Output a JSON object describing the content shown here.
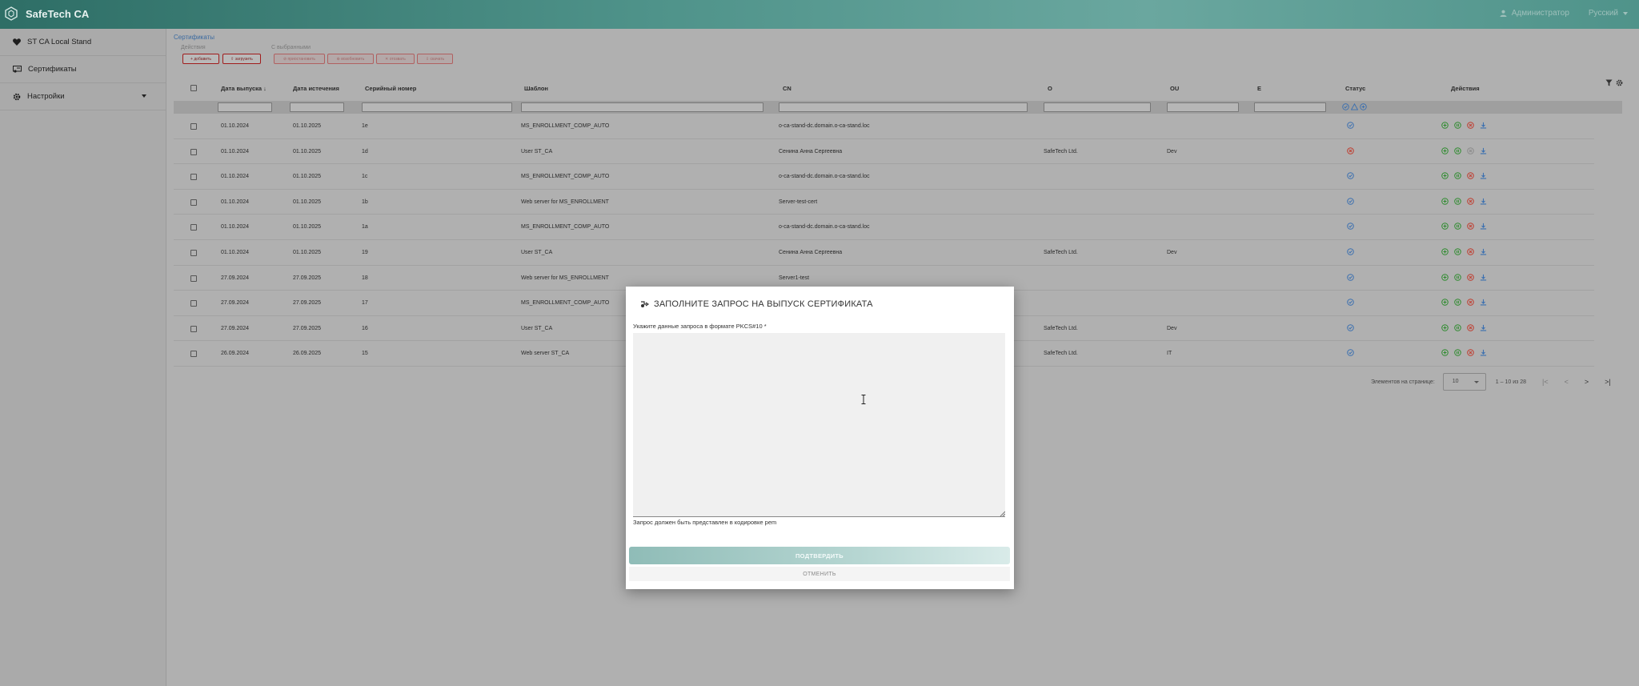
{
  "app": {
    "title": "SafeTech CA",
    "user": "Администратор",
    "language": "Русский"
  },
  "sidebar": {
    "items": [
      {
        "label": "ST CA Local Stand",
        "icon": "heart-icon"
      },
      {
        "label": "Сертификаты",
        "icon": "certificate-icon"
      },
      {
        "label": "Настройки",
        "icon": "gear-icon"
      }
    ]
  },
  "breadcrumb": "Сертификаты",
  "toolbar": {
    "actions_label": "Действия",
    "selected_label": "С выбранными",
    "add": "+ добавить",
    "upload": "⇧ загрузить",
    "b3": "⊘ приостановить",
    "b4": "⊕ возобновить",
    "b5": "✕ отозвать",
    "b6": "⇩ скачать"
  },
  "table": {
    "headers": {
      "issued": "Дата выпуска",
      "expires": "Дата истечения",
      "serial": "Серийный номер",
      "template": "Шаблон",
      "cn": "CN",
      "o": "O",
      "ou": "OU",
      "e": "E",
      "status": "Статус",
      "actions": "Действия"
    },
    "rows": [
      {
        "issued": "01.10.2024",
        "expires": "01.10.2025",
        "serial": "1e",
        "template": "MS_ENROLLMENT_COMP_AUTO",
        "cn": "o-ca-stand-dc.domain.o-ca-stand.loc",
        "o": "",
        "ou": "",
        "status": "valid"
      },
      {
        "issued": "01.10.2024",
        "expires": "01.10.2025",
        "serial": "1d",
        "template": "User ST_CA",
        "cn": "Сенина Анна Сергеевна",
        "o": "SafeTech Ltd.",
        "ou": "Dev",
        "status": "revoked"
      },
      {
        "issued": "01.10.2024",
        "expires": "01.10.2025",
        "serial": "1c",
        "template": "MS_ENROLLMENT_COMP_AUTO",
        "cn": "o-ca-stand-dc.domain.o-ca-stand.loc",
        "o": "",
        "ou": "",
        "status": "valid"
      },
      {
        "issued": "01.10.2024",
        "expires": "01.10.2025",
        "serial": "1b",
        "template": "Web server for MS_ENROLLMENT",
        "cn": "Server-test-cert",
        "o": "",
        "ou": "",
        "status": "valid"
      },
      {
        "issued": "01.10.2024",
        "expires": "01.10.2025",
        "serial": "1a",
        "template": "MS_ENROLLMENT_COMP_AUTO",
        "cn": "o-ca-stand-dc.domain.o-ca-stand.loc",
        "o": "",
        "ou": "",
        "status": "valid"
      },
      {
        "issued": "01.10.2024",
        "expires": "01.10.2025",
        "serial": "19",
        "template": "User ST_CA",
        "cn": "Сенина Анна Сергеевна",
        "o": "SafeTech Ltd.",
        "ou": "Dev",
        "status": "valid"
      },
      {
        "issued": "27.09.2024",
        "expires": "27.09.2025",
        "serial": "18",
        "template": "Web server for MS_ENROLLMENT",
        "cn": "Server1-test",
        "o": "",
        "ou": "",
        "status": "valid"
      },
      {
        "issued": "27.09.2024",
        "expires": "27.09.2025",
        "serial": "17",
        "template": "MS_ENROLLMENT_COMP_AUTO",
        "cn": "",
        "o": "",
        "ou": "",
        "status": "valid"
      },
      {
        "issued": "27.09.2024",
        "expires": "27.09.2025",
        "serial": "16",
        "template": "User ST_CA",
        "cn": "",
        "o": "SafeTech Ltd.",
        "ou": "Dev",
        "status": "valid"
      },
      {
        "issued": "26.09.2024",
        "expires": "26.09.2025",
        "serial": "15",
        "template": "Web server ST_CA",
        "cn": "",
        "o": "SafeTech Ltd.",
        "ou": "IT",
        "status": "valid"
      }
    ]
  },
  "pagination": {
    "per_page_label": "Элементов на странице:",
    "per_page": "10",
    "range": "1 – 10 из 28"
  },
  "modal": {
    "title": "ЗАПОЛНИТЕ ЗАПРОС НА ВЫПУСК СЕРТИФИКАТА",
    "field_label": "Укажите данные запроса в формате PKCS#10 *",
    "textarea_value": "",
    "hint": "Запрос должен быть представлен в кодировке pem",
    "confirm": "ПОДТВЕРДИТЬ",
    "cancel": "ОТМЕНИТЬ"
  },
  "colors": {
    "header": "#4f938a",
    "accent": "#8fbcb7",
    "danger": "#c0392b",
    "ok": "#2e8b2e",
    "link": "#3b6aa0"
  }
}
